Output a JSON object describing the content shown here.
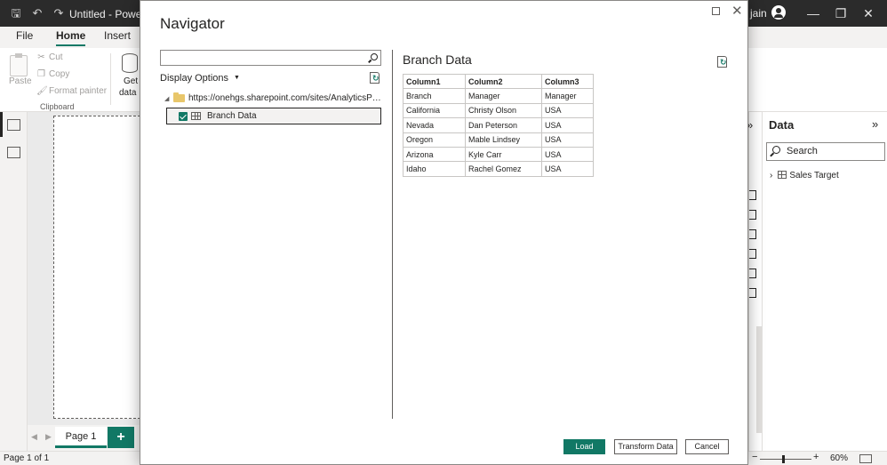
{
  "app": {
    "title": "Untitled - Power BI",
    "user_name": "jain",
    "ribbon_tabs": [
      "File",
      "Home",
      "Insert"
    ],
    "active_tab": "Home",
    "ribbon": {
      "paste_label": "Paste",
      "cut_label": "Cut",
      "copy_label": "Copy",
      "format_painter_label": "Format painter",
      "clipboard_group": "Clipboard",
      "get_data_label": "Get",
      "get_data_label2": "data"
    },
    "page_tab": "Page 1",
    "add_page": "+",
    "status": "Page 1 of 1",
    "zoom": "60%",
    "data_pane": {
      "title": "Data",
      "search_placeholder": "Search",
      "tables": [
        "Sales Target"
      ]
    }
  },
  "navigator": {
    "title": "Navigator",
    "search_value": "",
    "display_options": "Display Options",
    "source_url": "https://onehgs.sharepoint.com/sites/AnalyticsPrac...",
    "items": [
      {
        "label": "Branch Data",
        "checked": true,
        "selected": true
      }
    ],
    "preview": {
      "title": "Branch Data",
      "columns": [
        "Column1",
        "Column2",
        "Column3"
      ],
      "rows": [
        [
          "Branch",
          "Manager",
          "Manager"
        ],
        [
          "California",
          "Christy Olson",
          "USA"
        ],
        [
          "Nevada",
          "Dan Peterson",
          "USA"
        ],
        [
          "Oregon",
          "Mable Lindsey",
          "USA"
        ],
        [
          "Arizona",
          "Kyle Carr",
          "USA"
        ],
        [
          "Idaho",
          "Rachel Gomez",
          "USA"
        ]
      ]
    },
    "buttons": {
      "load": "Load",
      "transform": "Transform Data",
      "cancel": "Cancel"
    }
  },
  "colors": {
    "accent": "#117865",
    "titlebar": "#2b2b2b"
  }
}
